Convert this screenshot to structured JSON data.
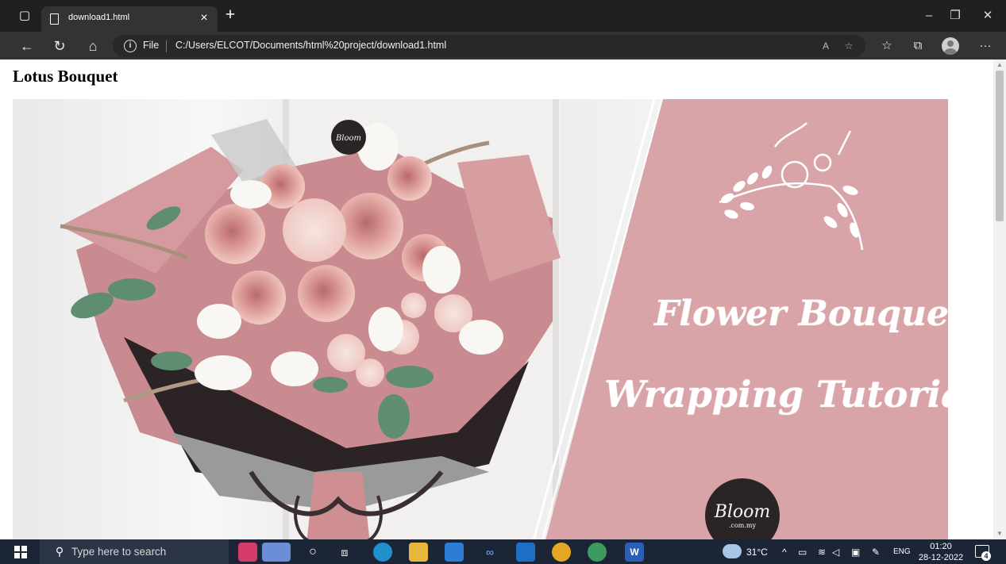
{
  "browser": {
    "tab_title": "download1.html",
    "tab_close_glyph": "×",
    "new_tab_glyph": "+",
    "address": {
      "scheme_label": "File",
      "url": "C:/Users/ELCOT/Documents/html%20project/download1.html"
    },
    "caption": {
      "minimize": "–",
      "restore": "❐",
      "close": "✕"
    },
    "more_menu": "···"
  },
  "page": {
    "heading": "Lotus Bouquet",
    "hero": {
      "line1": "Flower Bouquet",
      "line2": "Wrapping Tutorial",
      "brand_small": "Bloom",
      "brand_large": "Bloom",
      "brand_domain": ".com.my",
      "panel_color": "#d9a4a8",
      "wrap_color": "#c98b8f"
    }
  },
  "taskbar": {
    "search_placeholder": "Type here to search",
    "weather": "31°C",
    "language": "ENG",
    "time": "01:20",
    "date": "28-12-2022",
    "notification_count": "4"
  }
}
